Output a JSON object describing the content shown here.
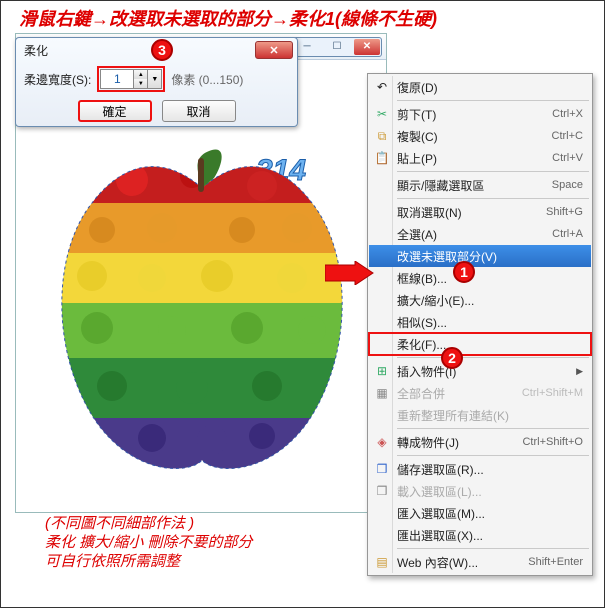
{
  "instruction": "滑鼠右鍵→改選取未選取的部分→柔化1(線條不生硬)",
  "dialog": {
    "title": "柔化",
    "label": "柔邊寬度(S):",
    "value": "1",
    "range": "像素 (0...150)",
    "ok": "確定",
    "cancel": "取消"
  },
  "watermark": "314",
  "markers": {
    "m1": "1",
    "m2": "2",
    "m3": "3"
  },
  "menu": {
    "undo": {
      "label": "復原(D)",
      "shortcut": ""
    },
    "cut": {
      "label": "剪下(T)",
      "shortcut": "Ctrl+X"
    },
    "copy": {
      "label": "複製(C)",
      "shortcut": "Ctrl+C"
    },
    "paste": {
      "label": "貼上(P)",
      "shortcut": "Ctrl+V"
    },
    "togglesel": {
      "label": "顯示/隱藏選取區",
      "shortcut": "Space"
    },
    "deselect": {
      "label": "取消選取(N)",
      "shortcut": "Shift+G"
    },
    "selectall": {
      "label": "全選(A)",
      "shortcut": "Ctrl+A"
    },
    "invert": {
      "label": "改選未選取部分(V)",
      "shortcut": ""
    },
    "border": {
      "label": "框線(B)...",
      "shortcut": ""
    },
    "scale": {
      "label": "擴大/縮小(E)...",
      "shortcut": ""
    },
    "similar": {
      "label": "相似(S)...",
      "shortcut": ""
    },
    "soften": {
      "label": "柔化(F)...",
      "shortcut": ""
    },
    "insertobj": {
      "label": "插入物件(I)",
      "shortcut": ""
    },
    "groupall": {
      "label": "全部合併",
      "shortcut": "Ctrl+Shift+M"
    },
    "relayout": {
      "label": "重新整理所有連結(K)",
      "shortcut": ""
    },
    "convert": {
      "label": "轉成物件(J)",
      "shortcut": "Ctrl+Shift+O"
    },
    "savesel": {
      "label": "儲存選取區(R)...",
      "shortcut": ""
    },
    "loadsel": {
      "label": "載入選取區(L)...",
      "shortcut": ""
    },
    "importsel": {
      "label": "匯入選取區(M)...",
      "shortcut": ""
    },
    "exportsel": {
      "label": "匯出選取區(X)...",
      "shortcut": ""
    },
    "webcontent": {
      "label": "Web 內容(W)...",
      "shortcut": "Shift+Enter"
    }
  },
  "footnotes": {
    "l1": "(不同圖不同細部作法 )",
    "l2": "柔化 擴大/縮小 刪除不要的部分",
    "l3": "可自行依照所需調整"
  }
}
